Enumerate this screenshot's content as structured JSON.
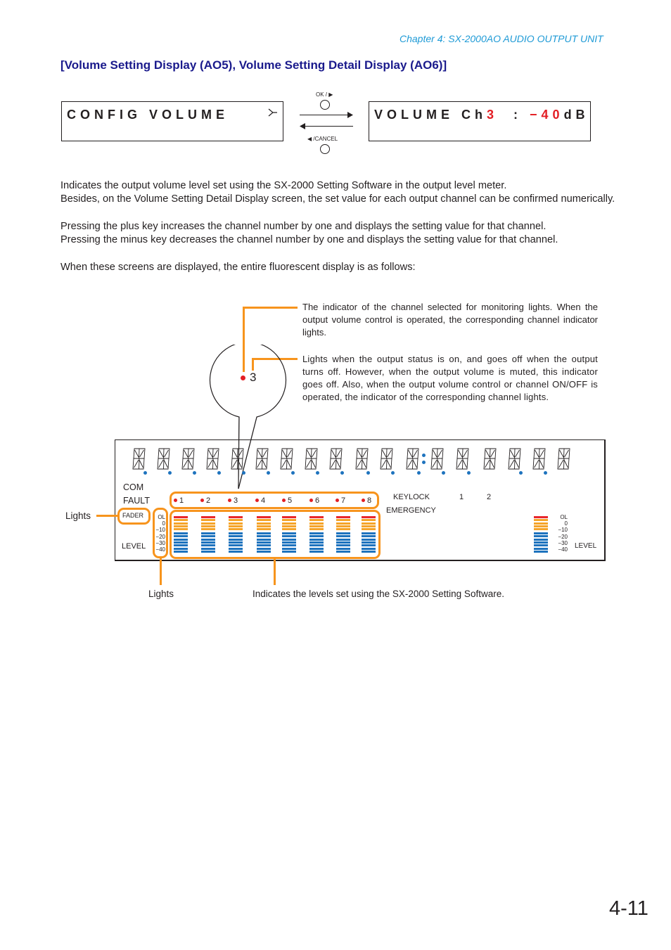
{
  "header": {
    "chapter": "Chapter 4:  SX-2000AO AUDIO OUTPUT UNIT"
  },
  "section_title": "[Volume Setting Display (AO5), Volume Setting Detail Display (AO6)]",
  "screens": {
    "config": {
      "text": "CONFIG VOLUME",
      "cursor_glyph": "⫍"
    },
    "volume": {
      "prefix": "VOLUME Ch",
      "channel": "3",
      "separator": "  : ",
      "value": "−40",
      "unit": "dB"
    },
    "nav": {
      "ok_label": "OK / ▶",
      "cancel_label": "◀ /CANCEL"
    }
  },
  "body_paragraphs": [
    "Indicates the output volume level set using the SX-2000 Setting Software in the output level meter.",
    "Besides, on the Volume Setting Detail Display screen, the set value for each output channel can be confirmed numerically.",
    "Pressing the plus key increases the channel number by one and displays the setting value for that channel.",
    "Pressing the minus key decreases the channel number by one and displays the setting value for that channel.",
    "When these screens are displayed, the entire fluorescent display is as follows:"
  ],
  "callouts": {
    "monitor_indicator": "The indicator of the channel selected for monitoring lights. When the output volume control is operated, the corresponding channel indicator lights.",
    "output_status": "Lights when the output status is on, and goes off when the output turns off. However, when the output volume is muted, this indicator goes off. Also, when the output volume control or channel ON/OFF is operated, the indicator of the corresponding channel lights.",
    "fader_lights": "Lights",
    "level_scale_lights": "Lights",
    "meters": "Indicates the levels set using the SX-2000 Setting Software."
  },
  "bubble": {
    "channel": "3"
  },
  "display_panel": {
    "com_label": "COM",
    "fault_label": "FAULT",
    "fader_label": "FADER",
    "level_label": "LEVEL",
    "keylock_label": "KEYLOCK",
    "emergency_label": "EMERGENCY",
    "keylock_nums": [
      "1",
      "2"
    ],
    "channels": [
      "1",
      "2",
      "3",
      "4",
      "5",
      "6",
      "7",
      "8"
    ],
    "scale_labels": [
      "OL",
      "0",
      "−10",
      "−20",
      "−30",
      "−40"
    ],
    "right_level_label": "LEVEL",
    "colors": {
      "red": "#e8262c",
      "orange": "#f5a42a",
      "blue": "#1e73be",
      "indicator_red": "#e31e24",
      "callout_orange": "#f7941d"
    }
  },
  "page_number": "4-11"
}
